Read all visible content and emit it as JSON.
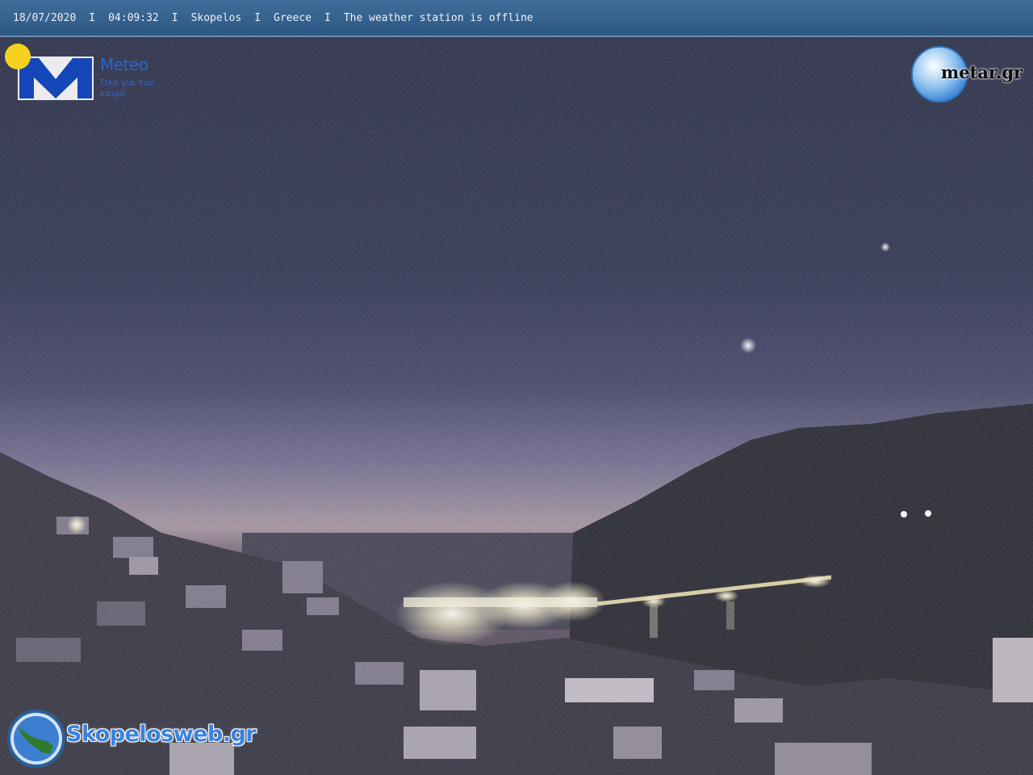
{
  "status_bar": {
    "date": "18/07/2020",
    "time": "04:09:32",
    "location": "Skopelos",
    "country": "Greece",
    "message": "The weather station is offline",
    "separator": "I"
  },
  "meteo_logo": {
    "name": "Meteo",
    "tagline": "Όλα για τον καιρό"
  },
  "metar_logo": {
    "name": "metar.gr"
  },
  "skopelos_logo": {
    "name": "Skopelosweb.gr"
  },
  "colors": {
    "bar": "#2e5884",
    "brand_blue": "#2a67c9",
    "sun_yellow": "#f4d21f",
    "night_sky": "#1a1b34"
  }
}
